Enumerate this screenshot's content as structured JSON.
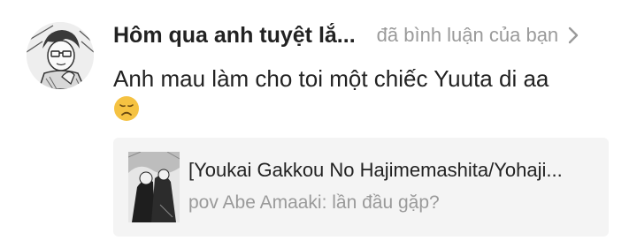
{
  "notification": {
    "author": "Hôm qua anh tuyệt lắ...",
    "action": "đã bình luận của bạn",
    "comment": "Anh mau làm cho toi một chiếc Yuuta di aa",
    "emoji": "disappointed-face-emoji"
  },
  "story": {
    "title": "[Youkai Gakkou No Hajimemashita/Yohaji...",
    "subtitle": "pov Abe Amaaki: lần đầu gặp?"
  },
  "colors": {
    "text_primary": "#222222",
    "text_secondary": "#9a9a9a",
    "card_background": "#f4f4f4",
    "emoji_face": "#f5c242"
  },
  "icons": {
    "avatar": "manga-avatar-image",
    "chevron": "chevron-right-icon",
    "cover": "story-cover-image"
  }
}
